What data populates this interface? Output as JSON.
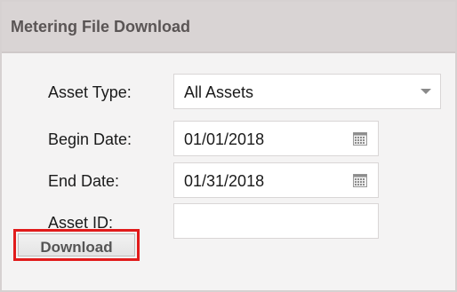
{
  "panel": {
    "title": "Metering File Download"
  },
  "form": {
    "asset_type": {
      "label": "Asset Type:",
      "value": "All Assets"
    },
    "begin_date": {
      "label": "Begin Date:",
      "value": "01/01/2018"
    },
    "end_date": {
      "label": "End Date:",
      "value": "01/31/2018"
    },
    "asset_id": {
      "label": "Asset ID:",
      "value": ""
    }
  },
  "actions": {
    "download_label": "Download"
  },
  "icons": {
    "dropdown": "chevron-down-icon",
    "date_picker": "calendar-icon"
  },
  "colors": {
    "highlight": "#e11b1b",
    "header_bg": "#d9d4d4",
    "panel_bg": "#f4f3f3"
  }
}
